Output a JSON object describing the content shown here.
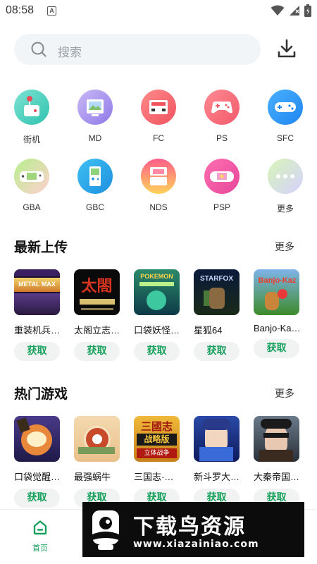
{
  "status_bar": {
    "time": "08:58",
    "notification_letter": "A"
  },
  "search": {
    "placeholder": "搜索"
  },
  "categories": [
    {
      "label": "街机",
      "icon": "arcade-icon"
    },
    {
      "label": "MD",
      "icon": "md-console-icon"
    },
    {
      "label": "FC",
      "icon": "fc-console-icon"
    },
    {
      "label": "PS",
      "icon": "ps-gamepad-icon"
    },
    {
      "label": "SFC",
      "icon": "sfc-gamepad-icon"
    },
    {
      "label": "GBA",
      "icon": "gba-handheld-icon"
    },
    {
      "label": "GBC",
      "icon": "gbc-handheld-icon"
    },
    {
      "label": "NDS",
      "icon": "nds-handheld-icon"
    },
    {
      "label": "PSP",
      "icon": "psp-handheld-icon"
    },
    {
      "label": "更多",
      "icon": "more-dots-icon"
    }
  ],
  "latest": {
    "title": "最新上传",
    "more": "更多",
    "items": [
      {
        "name": "重装机兵…",
        "art": "METAL MAX",
        "action": "获取"
      },
      {
        "name": "太阁立志…",
        "art": "太閤",
        "action": "获取"
      },
      {
        "name": "口袋妖怪…",
        "art": "POKEMON",
        "action": "获取"
      },
      {
        "name": "星狐64",
        "art": "STARFOX",
        "action": "获取"
      },
      {
        "name": "Banjo-Ka…",
        "art": "Banjo-Kaz",
        "action": "获取"
      }
    ]
  },
  "hot": {
    "title": "热门游戏",
    "more": "更多",
    "items": [
      {
        "name": "口袋觉醒…",
        "action": "获取"
      },
      {
        "name": "最强蜗牛",
        "action": "获取"
      },
      {
        "name": "三国志·…",
        "art": "三國志",
        "art2": "战略版",
        "art3": "立体战争",
        "action": "获取"
      },
      {
        "name": "新斗罗大…",
        "action": "获取"
      },
      {
        "name": "大秦帝国…",
        "action": "获取"
      }
    ]
  },
  "bottom_nav": {
    "home_label": "首页"
  },
  "watermark": {
    "title": "下载鸟资源",
    "url": "www.xiazainiao.com"
  },
  "colors": {
    "accent": "#17a05d",
    "search_bg": "#f2f5f8",
    "button_bg": "#f0f3f2"
  }
}
